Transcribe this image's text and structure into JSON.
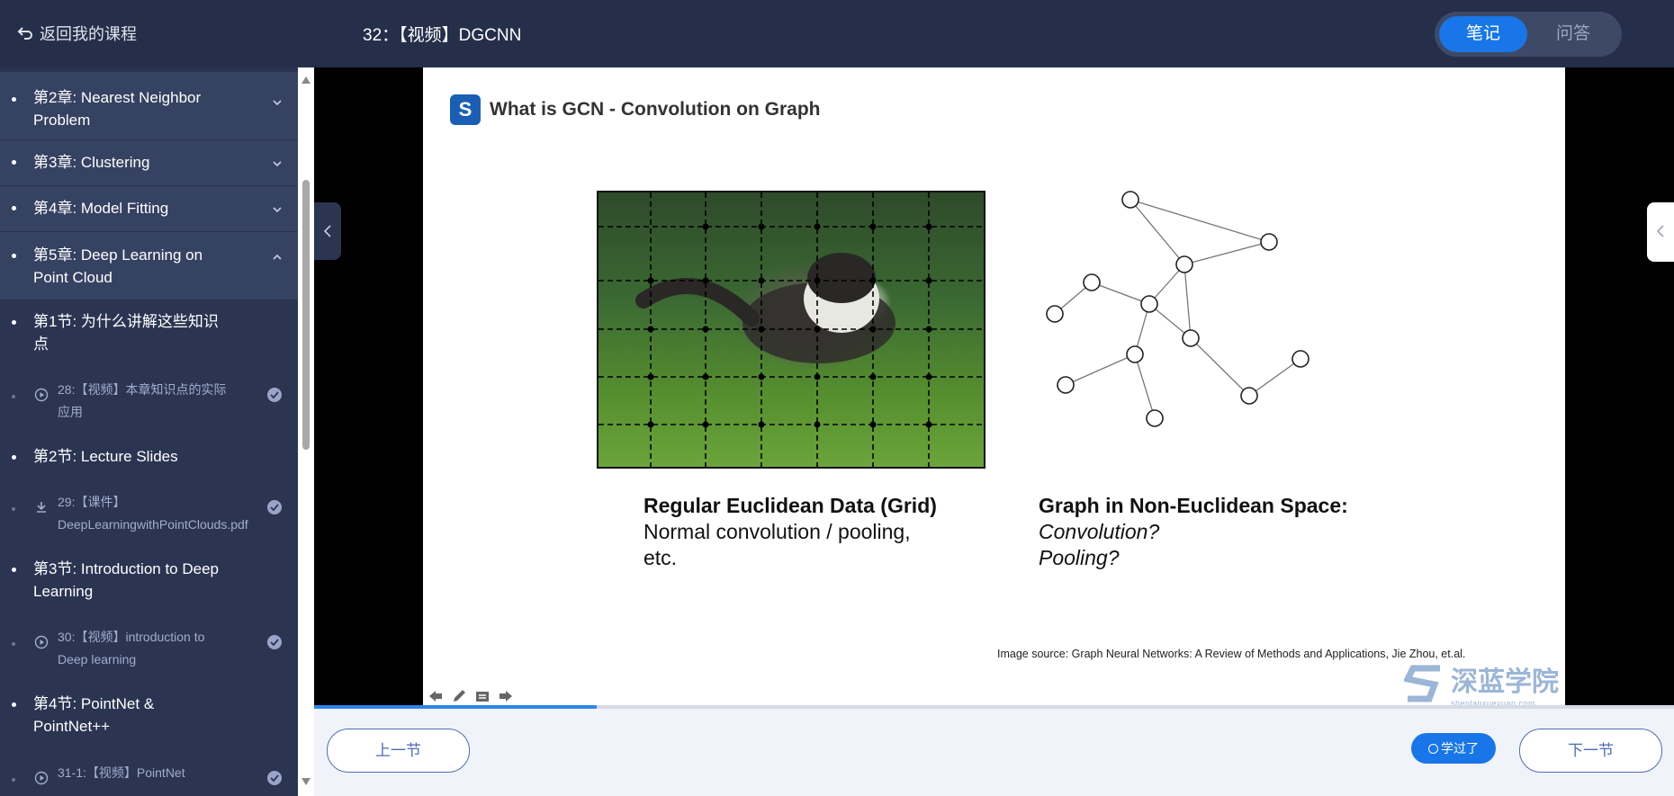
{
  "header": {
    "back_label": "返回我的课程",
    "lesson_title": "32：【视频】DGCNN",
    "tabs": {
      "notes": "笔记",
      "qa": "问答"
    }
  },
  "sidebar": {
    "chapters": [
      {
        "label": "第2章: Nearest Neighbor Problem"
      },
      {
        "label": "第3章: Clustering"
      },
      {
        "label": "第4章: Model Fitting"
      },
      {
        "label": "第5章: Deep Learning on Point Cloud"
      }
    ],
    "sections": [
      {
        "label": "第1节: 为什么讲解这些知识点"
      },
      {
        "label": "第2节: Lecture Slides"
      },
      {
        "label": "第3节: Introduction to Deep Learning"
      },
      {
        "label": "第4节: PointNet & PointNet++"
      }
    ],
    "items": [
      {
        "label": "28:【视频】本章知识点的实际应用",
        "icon": "play-circle-icon",
        "done": true
      },
      {
        "label": "29:【课件】DeepLearningwithPointClouds.pdf",
        "icon": "download-icon",
        "done": true
      },
      {
        "label": "30:【视频】introduction to Deep learning",
        "icon": "play-circle-icon",
        "done": true
      },
      {
        "label": "31-1:【视频】PointNet",
        "icon": "play-circle-icon",
        "done": true
      }
    ]
  },
  "slide": {
    "logo_letter": "S",
    "title": "What is GCN - Convolution on Graph",
    "left_caption_bold": "Regular Euclidean Data (Grid)",
    "left_caption_line2": "Normal convolution / pooling,",
    "left_caption_line3": "etc.",
    "right_caption_bold": "Graph in Non-Euclidean Space:",
    "right_caption_line2": "Convolution?",
    "right_caption_line3": "Pooling?",
    "source": "Image source: Graph Neural Networks: A Review of Methods and Applications, Jie Zhou, et.al.",
    "watermark": "深蓝学院",
    "watermark_sub": "shenlanxueyuan.com"
  },
  "player": {
    "progress": 0.208
  },
  "footer": {
    "prev_label": "上一节",
    "learned_label": "学过了",
    "next_label": "下一节"
  },
  "colors": {
    "accent": "#1976e8",
    "sidebar_bg": "#2b3552",
    "topbar_bg": "#262f4a"
  }
}
